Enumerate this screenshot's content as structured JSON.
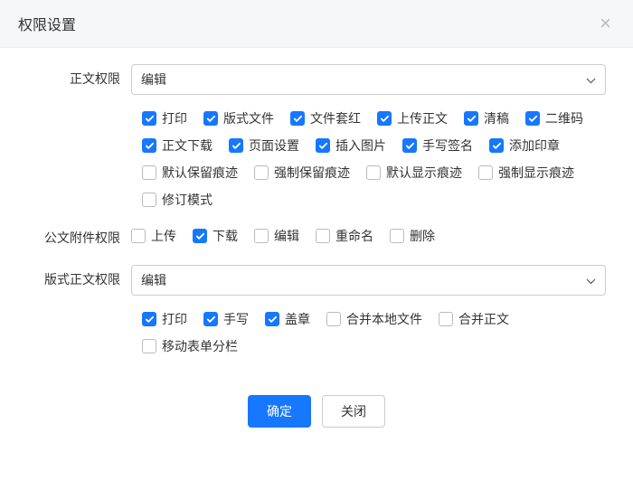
{
  "modal": {
    "title": "权限设置"
  },
  "section1": {
    "label": "正文权限",
    "select_value": "编辑",
    "checkboxes": [
      {
        "label": "打印",
        "checked": true
      },
      {
        "label": "版式文件",
        "checked": true
      },
      {
        "label": "文件套红",
        "checked": true
      },
      {
        "label": "上传正文",
        "checked": true
      },
      {
        "label": "清稿",
        "checked": true
      },
      {
        "label": "二维码",
        "checked": true
      },
      {
        "label": "正文下载",
        "checked": true
      },
      {
        "label": "页面设置",
        "checked": true
      },
      {
        "label": "插入图片",
        "checked": true
      },
      {
        "label": "手写签名",
        "checked": true
      },
      {
        "label": "添加印章",
        "checked": true
      },
      {
        "label": "默认保留痕迹",
        "checked": false
      },
      {
        "label": "强制保留痕迹",
        "checked": false
      },
      {
        "label": "默认显示痕迹",
        "checked": false
      },
      {
        "label": "强制显示痕迹",
        "checked": false
      },
      {
        "label": "修订模式",
        "checked": false
      }
    ]
  },
  "section2": {
    "label": "公文附件权限",
    "checkboxes": [
      {
        "label": "上传",
        "checked": false
      },
      {
        "label": "下载",
        "checked": true
      },
      {
        "label": "编辑",
        "checked": false
      },
      {
        "label": "重命名",
        "checked": false
      },
      {
        "label": "删除",
        "checked": false
      }
    ]
  },
  "section3": {
    "label": "版式正文权限",
    "select_value": "编辑",
    "checkboxes": [
      {
        "label": "打印",
        "checked": true
      },
      {
        "label": "手写",
        "checked": true
      },
      {
        "label": "盖章",
        "checked": true
      },
      {
        "label": "合并本地文件",
        "checked": false
      },
      {
        "label": "合并正文",
        "checked": false
      },
      {
        "label": "移动表单分栏",
        "checked": false
      }
    ]
  },
  "footer": {
    "confirm": "确定",
    "close": "关闭"
  }
}
